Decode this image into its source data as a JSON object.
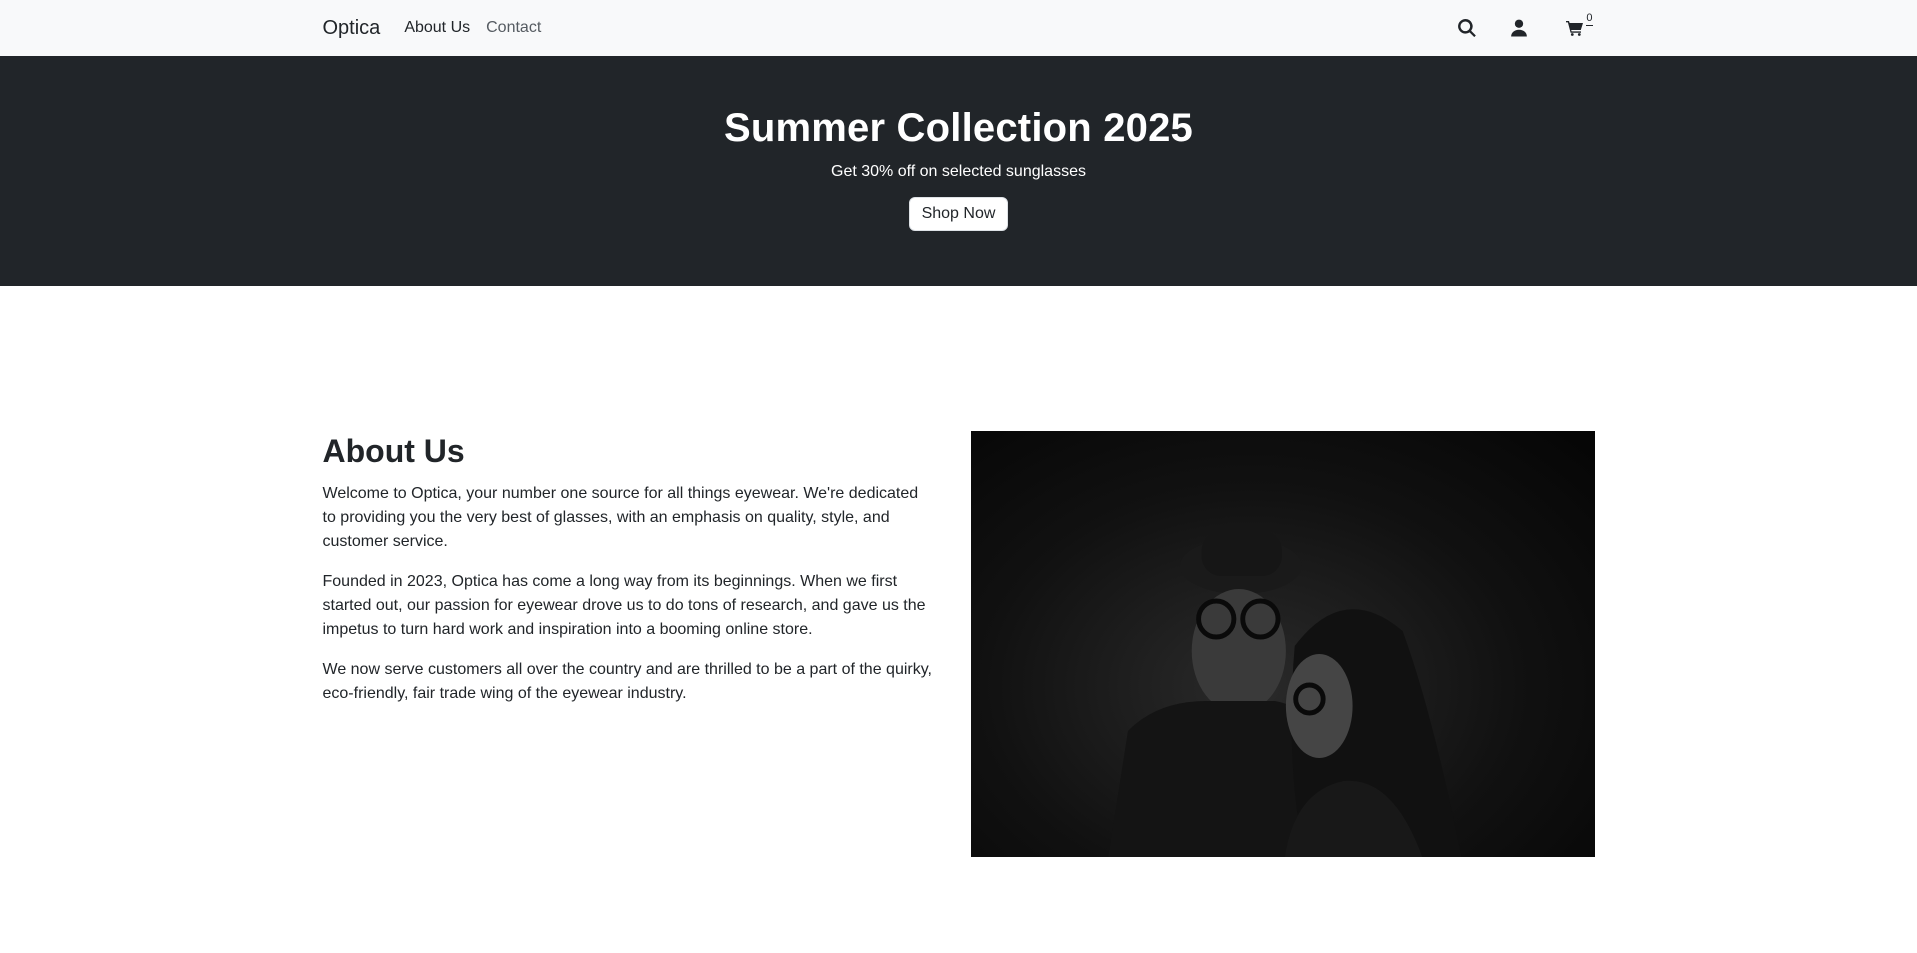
{
  "navbar": {
    "brand": "Optica",
    "links": [
      "About Us",
      "Contact"
    ],
    "cart_count": "0",
    "icons": [
      "search-icon",
      "user-icon",
      "cart-icon"
    ]
  },
  "hero": {
    "title": "Summer Collection 2025",
    "subtitle": "Get 30% off on selected sunglasses",
    "button": "Shop Now"
  },
  "about": {
    "heading": "About Us",
    "paragraphs": [
      "Welcome to Optica, your number one source for all things eyewear. We're dedicated to providing you the very best of glasses, with an emphasis on quality, style, and customer service.",
      "Founded in 2023, Optica has come a long way from its beginnings. When we first started out, our passion for eyewear drove us to do tons of research, and gave us the impetus to turn hard work and inspiration into a booming online store.",
      "We now serve customers all over the country and are thrilled to be a part of the quirky, eco-friendly, fair trade wing of the eyewear industry."
    ]
  },
  "colors": {
    "navbar_bg": "#f8f9fa",
    "hero_bg": "#212529",
    "text": "#212529"
  }
}
